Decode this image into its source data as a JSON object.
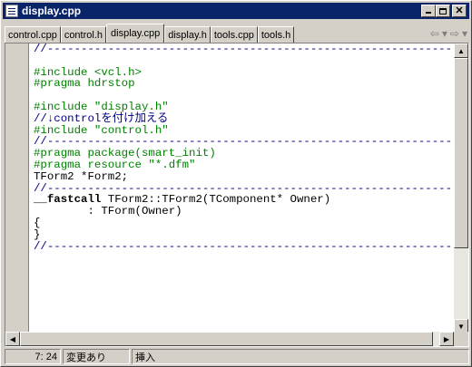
{
  "window": {
    "title": "display.cpp",
    "icon": "document-icon"
  },
  "tabs": [
    {
      "label": "control.cpp",
      "active": false
    },
    {
      "label": "control.h",
      "active": false
    },
    {
      "label": "display.cpp",
      "active": true
    },
    {
      "label": "display.h",
      "active": false
    },
    {
      "label": "tools.cpp",
      "active": false
    },
    {
      "label": "tools.h",
      "active": false
    }
  ],
  "nav": {
    "back": "⇦",
    "back_dropdown": "▾",
    "forward": "⇨",
    "forward_dropdown": "▾"
  },
  "code_lines": [
    {
      "text": "//---------------------------------------------------------------------------",
      "kind": "comment"
    },
    {
      "text": "",
      "kind": "plain"
    },
    {
      "text": "#include <vcl.h>",
      "kind": "pre"
    },
    {
      "text": "#pragma hdrstop",
      "kind": "pre"
    },
    {
      "text": "",
      "kind": "plain"
    },
    {
      "text": "#include \"display.h\"",
      "kind": "pre"
    },
    {
      "text": "//↓controlを付け加える",
      "kind": "comment"
    },
    {
      "text": "#include \"control.h\"",
      "kind": "pre"
    },
    {
      "text": "//---------------------------------------------------------------------------",
      "kind": "comment"
    },
    {
      "text": "#pragma package(smart_init)",
      "kind": "pre"
    },
    {
      "text": "#pragma resource \"*.dfm\"",
      "kind": "pre"
    },
    {
      "text": "TForm2 *Form2;",
      "kind": "plain"
    },
    {
      "text": "//---------------------------------------------------------------------------",
      "kind": "comment"
    },
    {
      "text": "__fastcall",
      "kind": "kw",
      "rest": " TForm2::TForm2(TComponent* Owner)"
    },
    {
      "text": "        : TForm(Owner)",
      "kind": "plain"
    },
    {
      "text": "{",
      "kind": "plain"
    },
    {
      "text": "}",
      "kind": "plain"
    },
    {
      "text": "//---------------------------------------------------------------------------",
      "kind": "comment"
    }
  ],
  "status": {
    "position": "7: 24",
    "modified": "変更あり",
    "mode": "挿入"
  },
  "colors": {
    "titlebar": "#0a246a",
    "comment": "#000080",
    "preprocessor": "#008000"
  }
}
